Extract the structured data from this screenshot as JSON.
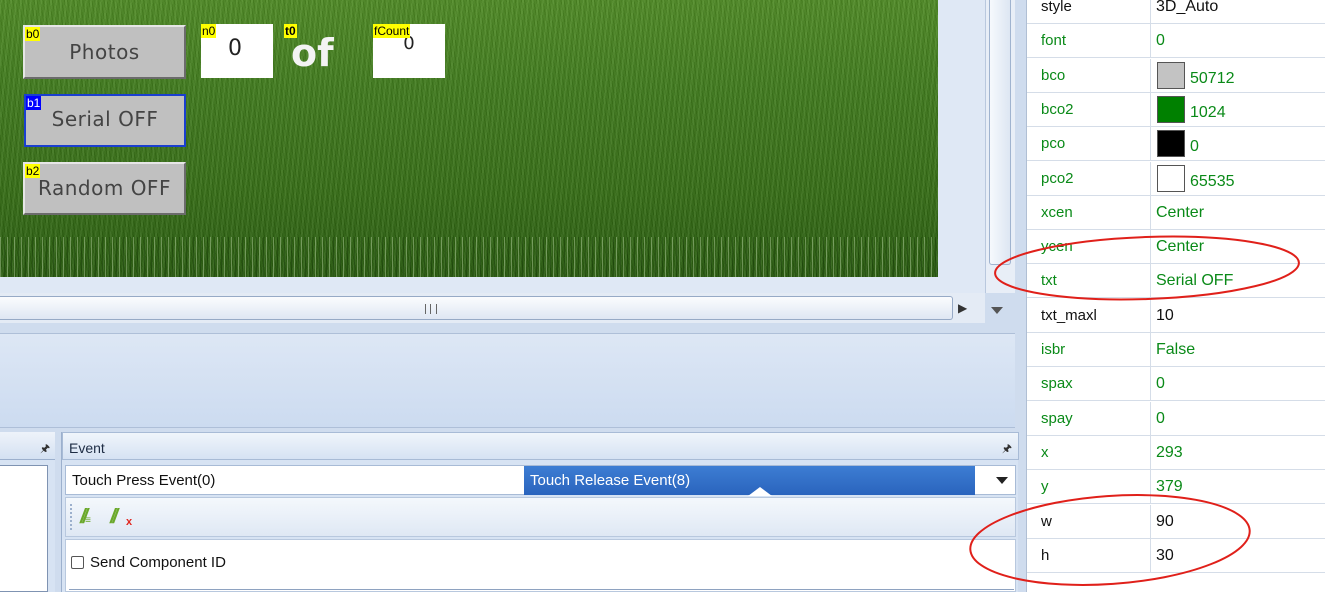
{
  "canvas": {
    "components": {
      "b0": {
        "tag": "b0",
        "label": "Photos"
      },
      "n0": {
        "tag": "n0",
        "value": "0"
      },
      "t0": {
        "tag": "t0",
        "text": "of"
      },
      "fcount": {
        "tag": "fCount",
        "value": "0"
      },
      "b1": {
        "tag": "b1",
        "label": "Serial OFF"
      },
      "b2": {
        "tag": "b2",
        "label": "Random OFF"
      }
    }
  },
  "event_panel": {
    "title": "Event",
    "tabs": [
      {
        "label": "Touch Press Event(0)",
        "active": false
      },
      {
        "label": "Touch Release Event(8)",
        "active": true
      }
    ],
    "send_component_id_label": "Send Component ID",
    "send_component_id_checked": false
  },
  "attributes": [
    {
      "name": "style",
      "value": "3D_Auto",
      "color": "#111111"
    },
    {
      "name": "font",
      "value": "0",
      "color": "#0a8a18"
    },
    {
      "name": "bco",
      "value": "50712",
      "color": "#0a8a18",
      "swatch": "#c3c3c3"
    },
    {
      "name": "bco2",
      "value": "1024",
      "color": "#0a8a18",
      "swatch": "#008000"
    },
    {
      "name": "pco",
      "value": "0",
      "color": "#0a8a18",
      "swatch": "#000000"
    },
    {
      "name": "pco2",
      "value": "65535",
      "color": "#0a8a18",
      "swatch": "#ffffff"
    },
    {
      "name": "xcen",
      "value": "Center",
      "color": "#0a8a18"
    },
    {
      "name": "ycen",
      "value": "Center",
      "color": "#0a8a18"
    },
    {
      "name": "txt",
      "value": "Serial OFF",
      "color": "#0a8a18"
    },
    {
      "name": "txt_maxl",
      "value": "10",
      "color": "#111111"
    },
    {
      "name": "isbr",
      "value": "False",
      "color": "#0a8a18"
    },
    {
      "name": "spax",
      "value": "0",
      "color": "#0a8a18"
    },
    {
      "name": "spay",
      "value": "0",
      "color": "#0a8a18"
    },
    {
      "name": "x",
      "value": "293",
      "color": "#0a8a18"
    },
    {
      "name": "y",
      "value": "379",
      "color": "#0a8a18"
    },
    {
      "name": "w",
      "value": "90",
      "color": "#111111"
    },
    {
      "name": "h",
      "value": "30",
      "color": "#111111"
    }
  ],
  "colors": {
    "annotation": "#e0201a",
    "selected_border": "#1a3fcf",
    "tab_active": "#2a64bd"
  }
}
